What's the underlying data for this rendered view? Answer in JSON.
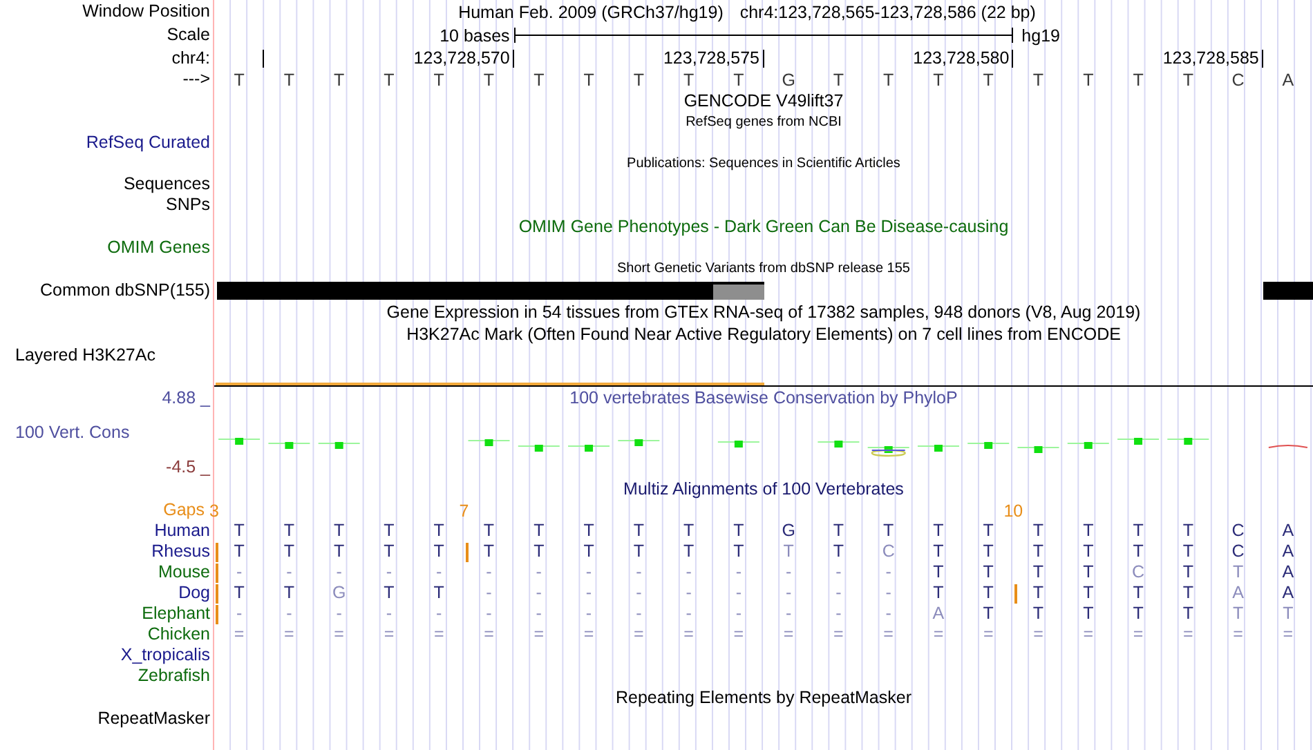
{
  "tracks": [
    {
      "kind": "header",
      "label": "Window Position",
      "assembly": "Human Feb. 2009 (GRCh37/hg19)",
      "position": "chr4:123,728,565-123,728,586 (22 bp)"
    },
    {
      "kind": "scale",
      "label": "Scale",
      "text": "10 bases",
      "assembly": "hg19"
    },
    {
      "kind": "ruler",
      "label": "chr4:",
      "ticks": [
        "123,728,570",
        "123,728,575",
        "123,728,580",
        "123,728,585"
      ]
    },
    {
      "kind": "bases",
      "label": "--->",
      "bases": [
        "T",
        "T",
        "T",
        "T",
        "T",
        "T",
        "T",
        "T",
        "T",
        "T",
        "T",
        "G",
        "T",
        "T",
        "T",
        "T",
        "T",
        "T",
        "T",
        "T",
        "C",
        "A"
      ]
    },
    {
      "kind": "title",
      "title": "GENCODE V49lift37"
    },
    {
      "kind": "subtitle",
      "title": "RefSeq genes from NCBI"
    },
    {
      "kind": "label",
      "label": "RefSeq Curated",
      "color": "#1a1a8c"
    },
    {
      "kind": "subtitle",
      "title": "Publications: Sequences in Scientific Articles"
    },
    {
      "kind": "label",
      "label": "Sequences"
    },
    {
      "kind": "label",
      "label": "SNPs"
    },
    {
      "kind": "title",
      "title": "OMIM Gene Phenotypes - Dark Green Can Be Disease-causing",
      "color": "#0d6b0d"
    },
    {
      "kind": "label",
      "label": "OMIM Genes",
      "color": "#0d6b0d"
    },
    {
      "kind": "subtitle",
      "title": "Short Genetic Variants from dbSNP release 155"
    },
    {
      "kind": "variants",
      "label": "Common dbSNP(155)",
      "bar": [
        {
          "kind": "common"
        },
        {
          "kind": "common"
        },
        {
          "kind": "common"
        },
        {
          "kind": "common"
        },
        {
          "kind": "common"
        },
        {
          "kind": "common"
        },
        {
          "kind": "common"
        },
        {
          "kind": "common"
        },
        {
          "kind": "common"
        },
        {
          "kind": "common"
        },
        {
          "kind": "partial"
        },
        {
          "kind": "none"
        },
        {
          "kind": "none"
        },
        {
          "kind": "none"
        },
        {
          "kind": "none"
        },
        {
          "kind": "none"
        },
        {
          "kind": "none"
        },
        {
          "kind": "none"
        },
        {
          "kind": "none"
        },
        {
          "kind": "none"
        },
        {
          "kind": "none"
        },
        {
          "kind": "common"
        }
      ]
    },
    {
      "kind": "title",
      "title": "Gene Expression in 54 tissues from GTEx RNA-seq of 17382 samples, 948 donors (V8, Aug 2019)"
    },
    {
      "kind": "title",
      "title": "H3K27Ac Mark (Often Found Near Active Regulatory Elements) on 7 cell lines from ENCODE"
    },
    {
      "kind": "layered",
      "label": "Layered H3K27Ac"
    },
    {
      "kind": "conservation",
      "title": "100 vertebrates Basewise Conservation by PhyloP",
      "label": "100 Vert. Cons",
      "max": "4.88 _",
      "min": "-4.5 _",
      "color": "#4f4f9f"
    },
    {
      "kind": "alignment",
      "title": "Multiz Alignments of 100 Vertebrates",
      "color": "#1a1a6e",
      "gap_label": "Gaps",
      "species": [
        {
          "name": "Human",
          "color": "#1a1a8c",
          "bases": [
            {
              "base": "T",
              "match": true,
              "insert": "3"
            },
            {
              "base": "T",
              "match": true
            },
            {
              "base": "T",
              "match": true
            },
            {
              "base": "T",
              "match": true
            },
            {
              "base": "T",
              "match": true
            },
            {
              "base": "T",
              "match": true,
              "insert": "7"
            },
            {
              "base": "T",
              "match": true
            },
            {
              "base": "T",
              "match": true
            },
            {
              "base": "T",
              "match": true
            },
            {
              "base": "T",
              "match": true
            },
            {
              "base": "T",
              "match": true
            },
            {
              "base": "G",
              "match": true
            },
            {
              "base": "T",
              "match": true
            },
            {
              "base": "T",
              "match": true
            },
            {
              "base": "T",
              "match": true
            },
            {
              "base": "T",
              "match": true
            },
            {
              "base": "T",
              "match": true,
              "insert": "10"
            },
            {
              "base": "T",
              "match": true
            },
            {
              "base": "T",
              "match": true
            },
            {
              "base": "T",
              "match": true
            },
            {
              "base": "C",
              "match": true
            },
            {
              "base": "A",
              "match": true
            }
          ]
        },
        {
          "name": "Rhesus",
          "color": "#1a1a8c",
          "bases": [
            {
              "base": "T",
              "match": true,
              "gap": true
            },
            {
              "base": "T",
              "match": true
            },
            {
              "base": "T",
              "match": true
            },
            {
              "base": "T",
              "match": true
            },
            {
              "base": "T",
              "match": true
            },
            {
              "base": "T",
              "match": true,
              "gap": true
            },
            {
              "base": "T",
              "match": true
            },
            {
              "base": "T",
              "match": true
            },
            {
              "base": "T",
              "match": true
            },
            {
              "base": "T",
              "match": true
            },
            {
              "base": "T",
              "match": true
            },
            {
              "base": "T",
              "match": false
            },
            {
              "base": "T",
              "match": true
            },
            {
              "base": "C",
              "match": false
            },
            {
              "base": "T",
              "match": true
            },
            {
              "base": "T",
              "match": true
            },
            {
              "base": "T",
              "match": true
            },
            {
              "base": "T",
              "match": true
            },
            {
              "base": "T",
              "match": true
            },
            {
              "base": "T",
              "match": true
            },
            {
              "base": "C",
              "match": true
            },
            {
              "base": "A",
              "match": true
            }
          ]
        },
        {
          "name": "Mouse",
          "color": "#0d6b0d",
          "bases": [
            {
              "base": "-",
              "match": false,
              "gap": true
            },
            {
              "base": "-",
              "match": false
            },
            {
              "base": "-",
              "match": false
            },
            {
              "base": "-",
              "match": false
            },
            {
              "base": "-",
              "match": false
            },
            {
              "base": "-",
              "match": false
            },
            {
              "base": "-",
              "match": false
            },
            {
              "base": "-",
              "match": false
            },
            {
              "base": "-",
              "match": false
            },
            {
              "base": "-",
              "match": false
            },
            {
              "base": "-",
              "match": false
            },
            {
              "base": "-",
              "match": false
            },
            {
              "base": "-",
              "match": false
            },
            {
              "base": "-",
              "match": false
            },
            {
              "base": "T",
              "match": true
            },
            {
              "base": "T",
              "match": true
            },
            {
              "base": "T",
              "match": true
            },
            {
              "base": "T",
              "match": true
            },
            {
              "base": "C",
              "match": false
            },
            {
              "base": "T",
              "match": true
            },
            {
              "base": "T",
              "match": false
            },
            {
              "base": "A",
              "match": true
            }
          ]
        },
        {
          "name": "Dog",
          "color": "#1a1a8c",
          "bases": [
            {
              "base": "T",
              "match": true,
              "gap": true
            },
            {
              "base": "T",
              "match": true
            },
            {
              "base": "G",
              "match": false
            },
            {
              "base": "T",
              "match": true
            },
            {
              "base": "T",
              "match": true
            },
            {
              "base": "-",
              "match": false
            },
            {
              "base": "-",
              "match": false
            },
            {
              "base": "-",
              "match": false
            },
            {
              "base": "-",
              "match": false
            },
            {
              "base": "-",
              "match": false
            },
            {
              "base": "-",
              "match": false
            },
            {
              "base": "-",
              "match": false
            },
            {
              "base": "-",
              "match": false
            },
            {
              "base": "-",
              "match": false
            },
            {
              "base": "T",
              "match": true
            },
            {
              "base": "T",
              "match": true
            },
            {
              "base": "T",
              "match": true,
              "gap": true
            },
            {
              "base": "T",
              "match": true
            },
            {
              "base": "T",
              "match": true
            },
            {
              "base": "T",
              "match": true
            },
            {
              "base": "A",
              "match": false
            },
            {
              "base": "A",
              "match": true
            }
          ]
        },
        {
          "name": "Elephant",
          "color": "#0d6b0d",
          "bases": [
            {
              "base": "-",
              "match": false,
              "gap": true
            },
            {
              "base": "-",
              "match": false
            },
            {
              "base": "-",
              "match": false
            },
            {
              "base": "-",
              "match": false
            },
            {
              "base": "-",
              "match": false
            },
            {
              "base": "-",
              "match": false
            },
            {
              "base": "-",
              "match": false
            },
            {
              "base": "-",
              "match": false
            },
            {
              "base": "-",
              "match": false
            },
            {
              "base": "-",
              "match": false
            },
            {
              "base": "-",
              "match": false
            },
            {
              "base": "-",
              "match": false
            },
            {
              "base": "-",
              "match": false
            },
            {
              "base": "-",
              "match": false
            },
            {
              "base": "A",
              "match": false
            },
            {
              "base": "T",
              "match": true
            },
            {
              "base": "T",
              "match": true
            },
            {
              "base": "T",
              "match": true
            },
            {
              "base": "T",
              "match": true
            },
            {
              "base": "T",
              "match": true
            },
            {
              "base": "T",
              "match": false
            },
            {
              "base": "T",
              "match": false
            }
          ]
        },
        {
          "name": "Chicken",
          "color": "#0d6b0d",
          "bases": [
            {
              "base": "=",
              "match": false
            },
            {
              "base": "=",
              "match": false
            },
            {
              "base": "=",
              "match": false
            },
            {
              "base": "=",
              "match": false
            },
            {
              "base": "=",
              "match": false
            },
            {
              "base": "=",
              "match": false
            },
            {
              "base": "=",
              "match": false
            },
            {
              "base": "=",
              "match": false
            },
            {
              "base": "=",
              "match": false
            },
            {
              "base": "=",
              "match": false
            },
            {
              "base": "=",
              "match": false
            },
            {
              "base": "=",
              "match": false
            },
            {
              "base": "=",
              "match": false
            },
            {
              "base": "=",
              "match": false
            },
            {
              "base": "=",
              "match": false
            },
            {
              "base": "=",
              "match": false
            },
            {
              "base": "=",
              "match": false
            },
            {
              "base": "=",
              "match": false
            },
            {
              "base": "=",
              "match": false
            },
            {
              "base": "=",
              "match": false
            },
            {
              "base": "=",
              "match": false
            },
            {
              "base": "=",
              "match": false
            }
          ]
        },
        {
          "name": "X_tropicalis",
          "color": "#1a1a8c"
        },
        {
          "name": "Zebrafish",
          "color": "#0d6b0d"
        }
      ]
    },
    {
      "kind": "title",
      "title": "Repeating Elements by RepeatMasker"
    },
    {
      "kind": "label",
      "label": "RepeatMasker"
    }
  ]
}
